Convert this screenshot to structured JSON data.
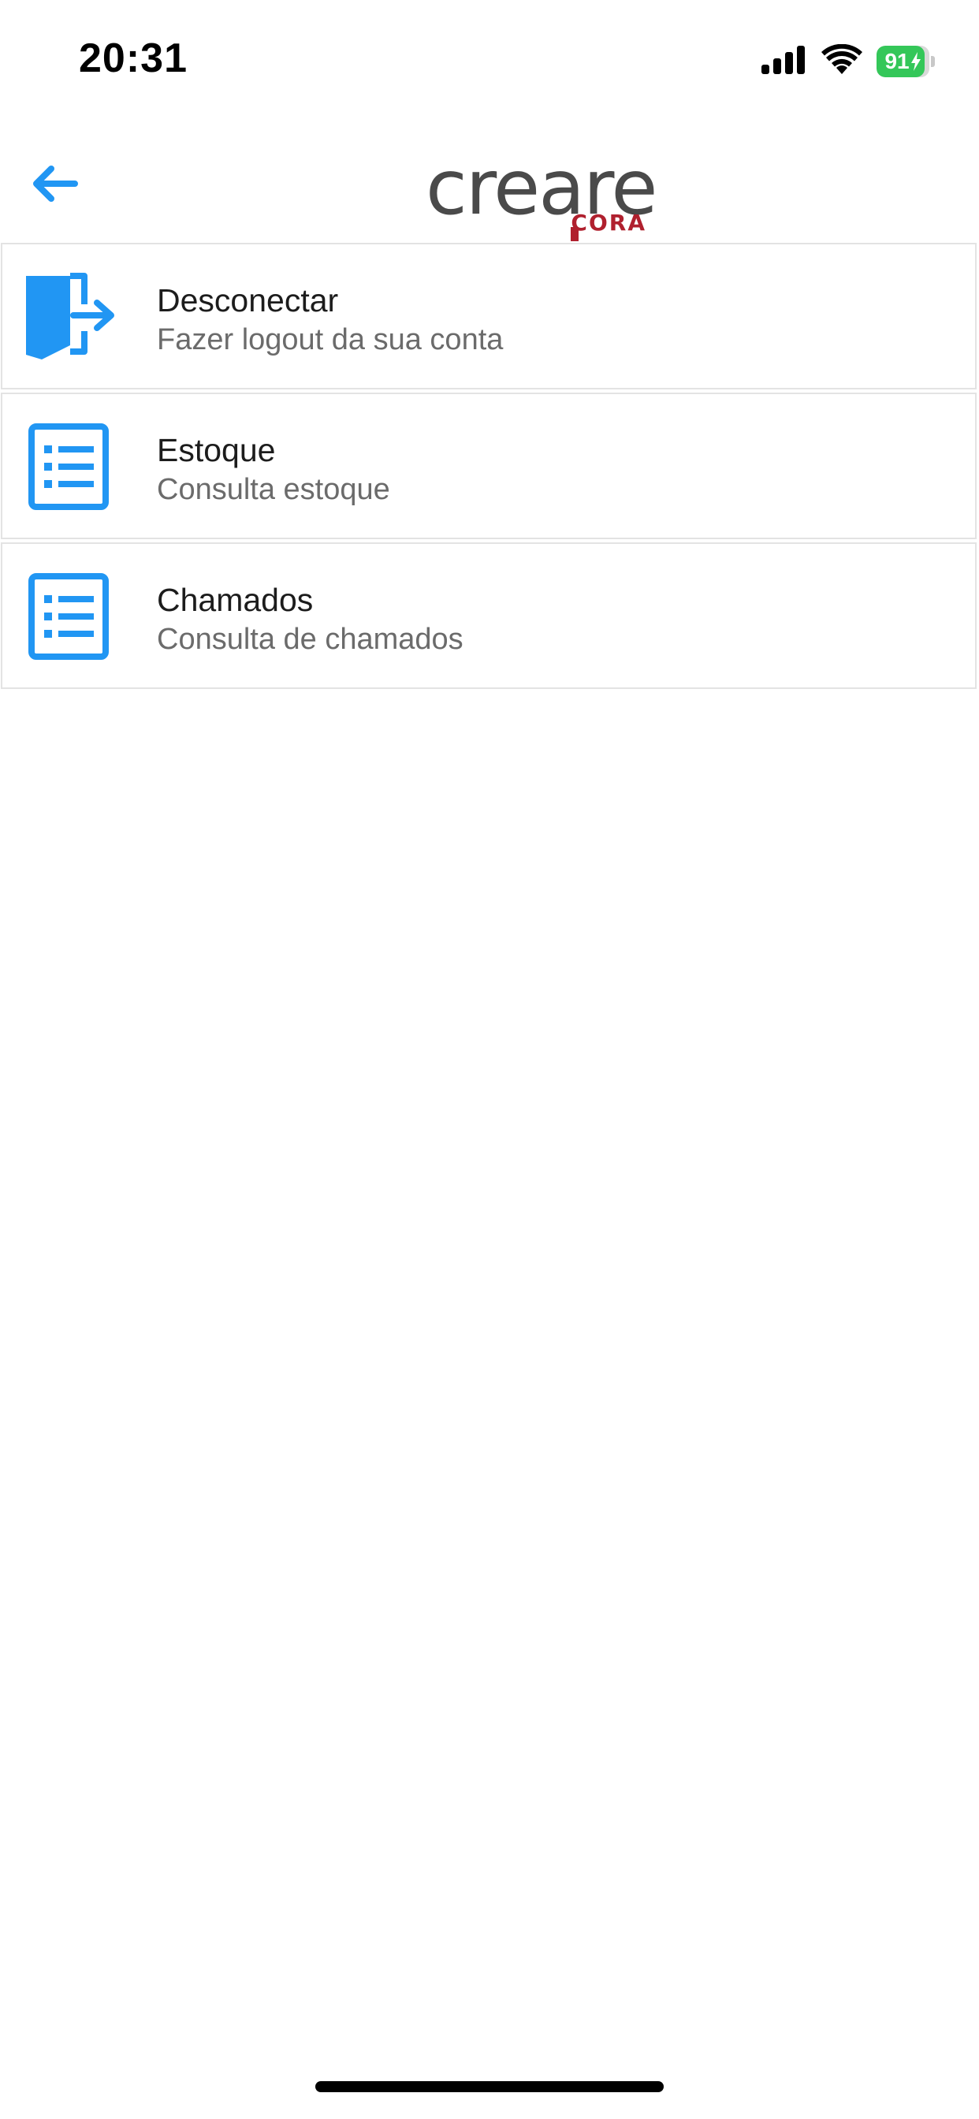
{
  "status_bar": {
    "time": "20:31",
    "battery_percent": "91",
    "battery_level": 0.91,
    "icons": [
      "cellular-signal-icon",
      "wifi-icon",
      "battery-charging-icon"
    ]
  },
  "header": {
    "back_icon": "arrow-left-icon",
    "logo": {
      "brand": "creare",
      "product": "CORA"
    }
  },
  "colors": {
    "accent": "#2196f3",
    "logo_gray": "#4a4a4a",
    "logo_red": "#b0202e",
    "battery_green": "#34c759"
  },
  "menu": {
    "items": [
      {
        "icon": "logout-door-icon",
        "title": "Desconectar",
        "subtitle": "Fazer logout da sua conta"
      },
      {
        "icon": "list-icon",
        "title": "Estoque",
        "subtitle": "Consulta estoque"
      },
      {
        "icon": "list-icon",
        "title": "Chamados",
        "subtitle": "Consulta de chamados"
      }
    ]
  }
}
